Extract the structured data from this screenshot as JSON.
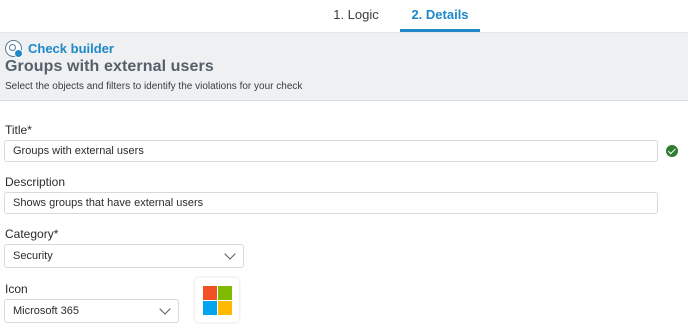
{
  "tabs": [
    {
      "label": "1. Logic"
    },
    {
      "label": "2. Details"
    }
  ],
  "header": {
    "builder_label": "Check builder",
    "title": "Groups with external users",
    "subtitle": "Select the objects and filters to identify the violations for your check"
  },
  "form": {
    "title": {
      "label": "Title*",
      "value": "Groups with external users"
    },
    "description": {
      "label": "Description",
      "value": "Shows groups that have external users"
    },
    "category": {
      "label": "Category*",
      "selected": "Security"
    },
    "icon": {
      "label": "Icon",
      "selected": "Microsoft 365"
    }
  },
  "icons": {
    "builder": "check-builder-icon",
    "valid": "checkmark-circle-icon",
    "chevron": "chevron-down-icon",
    "preview": "microsoft-logo-icon"
  },
  "colors": {
    "accent": "#1e88c9",
    "valid": "#2e7d32",
    "ms_red": "#f25022",
    "ms_green": "#7fba00",
    "ms_blue": "#00a4ef",
    "ms_yellow": "#ffb900"
  }
}
